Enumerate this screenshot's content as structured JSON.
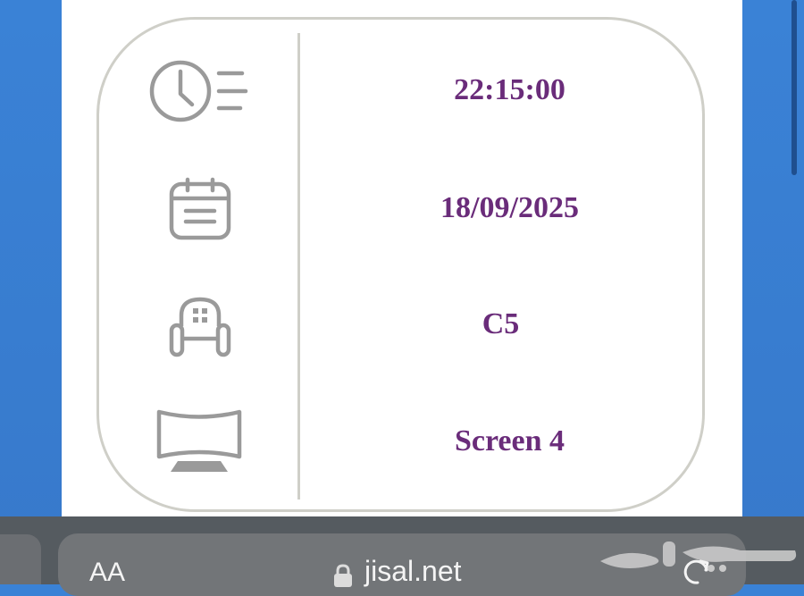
{
  "ticket": {
    "time": "22:15:00",
    "date": "18/09/2025",
    "seat": "C5",
    "screen": "Screen 4"
  },
  "icons": {
    "time": "clock-list-icon",
    "date": "calendar-icon",
    "seat": "armchair-icon",
    "screen": "cinema-screen-icon"
  },
  "browser": {
    "text_size_label": "AA",
    "url": "jisal.net"
  },
  "colors": {
    "value_text": "#6a2c7a",
    "icon_gray": "#9a9a9a",
    "card_border": "#cfcfc8",
    "background_blue": "#3a82d6"
  }
}
